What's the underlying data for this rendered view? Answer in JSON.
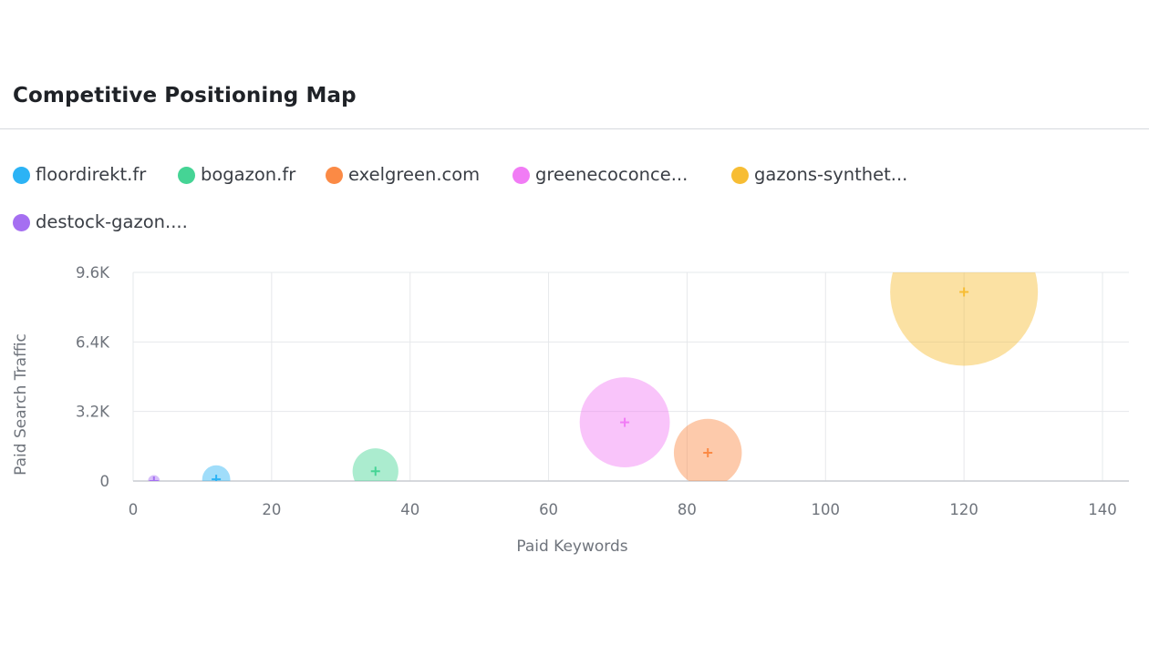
{
  "widget": {
    "title": "Competitive Positioning Map"
  },
  "legend": {
    "items": [
      {
        "label": "floordirekt.fr",
        "color": "#2cb3f5"
      },
      {
        "label": "bogazon.fr",
        "color": "#45d495"
      },
      {
        "label": "exelgreen.com",
        "color": "#fb8a45"
      },
      {
        "label": "greenecoconce...",
        "color": "#f17cf5"
      },
      {
        "label": "gazons-synthet...",
        "color": "#f7bd34"
      },
      {
        "label": "destock-gazon....",
        "color": "#a56ff1"
      }
    ]
  },
  "chart_data": {
    "type": "scatter",
    "xlabel": "Paid Keywords",
    "ylabel": "Paid Search Traffic",
    "xlim": [
      0,
      140
    ],
    "ylim": [
      0,
      9600
    ],
    "x_ticks": [
      0,
      20,
      40,
      60,
      80,
      100,
      120,
      140
    ],
    "x_tick_labels": [
      "0",
      "20",
      "40",
      "60",
      "80",
      "100",
      "120",
      "140"
    ],
    "y_ticks": [
      0,
      3200,
      6400,
      9600
    ],
    "y_tick_labels": [
      "0",
      "3.2K",
      "6.4K",
      "9.6K"
    ],
    "grid": true,
    "series": [
      {
        "name": "floordirekt.fr",
        "color": "#2cb3f5",
        "x": 12,
        "y": 80,
        "size": 0.19
      },
      {
        "name": "bogazon.fr",
        "color": "#45d495",
        "x": 35,
        "y": 450,
        "size": 0.31
      },
      {
        "name": "exelgreen.com",
        "color": "#fb8a45",
        "x": 83,
        "y": 1300,
        "size": 0.46
      },
      {
        "name": "greenecoconce...",
        "color": "#f17cf5",
        "x": 71,
        "y": 2700,
        "size": 0.61
      },
      {
        "name": "gazons-synthet...",
        "color": "#f7bd34",
        "x": 120,
        "y": 8700,
        "size": 1.0
      },
      {
        "name": "destock-gazon....",
        "color": "#a56ff1",
        "x": 3,
        "y": 0,
        "size": 0.08
      }
    ]
  }
}
